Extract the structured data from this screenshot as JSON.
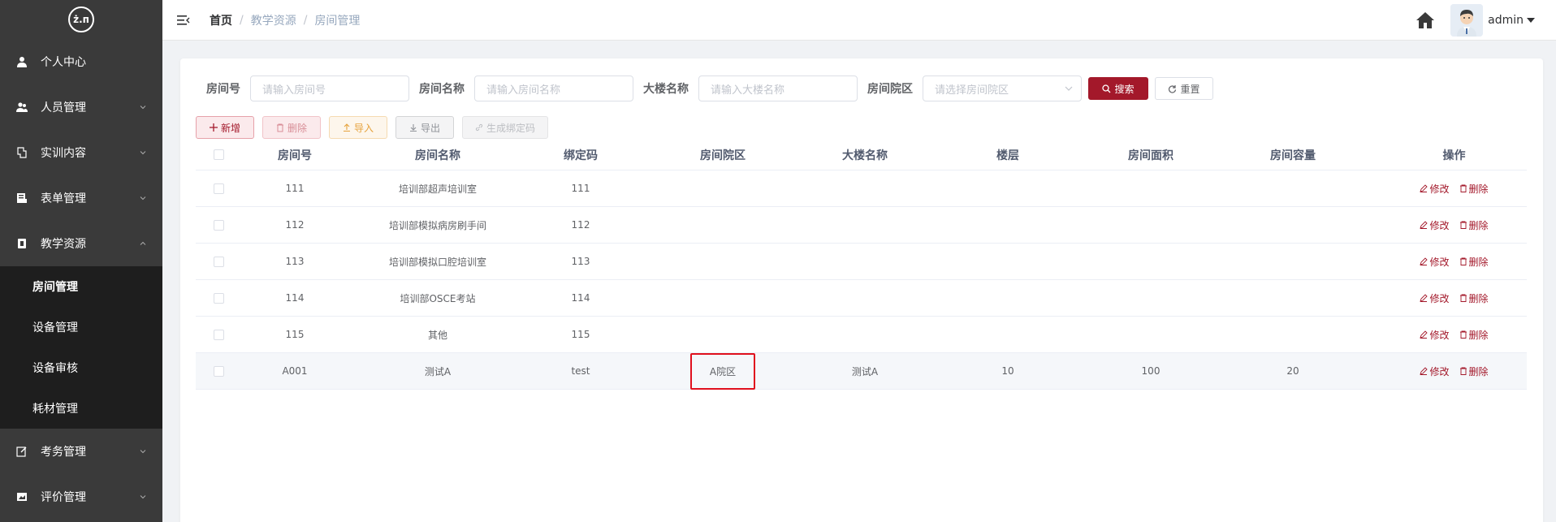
{
  "logo": {
    "text": "ż.п"
  },
  "sidebar": {
    "items": [
      {
        "label": "个人中心",
        "icon": "user-icon",
        "expandable": false
      },
      {
        "label": "人员管理",
        "icon": "people-icon",
        "expandable": true
      },
      {
        "label": "实训内容",
        "icon": "book-icon",
        "expandable": true
      },
      {
        "label": "表单管理",
        "icon": "form-icon",
        "expandable": true
      },
      {
        "label": "教学资源",
        "icon": "resource-icon",
        "expandable": true,
        "open": true
      },
      {
        "label": "考务管理",
        "icon": "edit-icon",
        "expandable": true
      },
      {
        "label": "评价管理",
        "icon": "image-icon",
        "expandable": true
      }
    ],
    "submenu": [
      {
        "label": "房间管理",
        "active": true
      },
      {
        "label": "设备管理"
      },
      {
        "label": "设备审核"
      },
      {
        "label": "耗材管理"
      }
    ]
  },
  "header": {
    "breadcrumb": [
      "首页",
      "教学资源",
      "房间管理"
    ],
    "username": "admin"
  },
  "search": {
    "room_no_label": "房间号",
    "room_no_placeholder": "请输入房间号",
    "room_name_label": "房间名称",
    "room_name_placeholder": "请输入房间名称",
    "building_label": "大楼名称",
    "building_placeholder": "请输入大楼名称",
    "campus_label": "房间院区",
    "campus_placeholder": "请选择房间院区",
    "search_btn": "搜索",
    "reset_btn": "重置"
  },
  "toolbar": {
    "add": "新增",
    "delete": "删除",
    "import": "导入",
    "export": "导出",
    "generate": "生成绑定码"
  },
  "table": {
    "columns": [
      "房间号",
      "房间名称",
      "绑定码",
      "房间院区",
      "大楼名称",
      "楼层",
      "房间面积",
      "房间容量",
      "操作"
    ],
    "rows": [
      {
        "no": "111",
        "name": "培训部超声培训室",
        "code": "111",
        "campus": "",
        "building": "",
        "floor": "",
        "area": "",
        "capacity": ""
      },
      {
        "no": "112",
        "name": "培训部模拟病房刷手间",
        "code": "112",
        "campus": "",
        "building": "",
        "floor": "",
        "area": "",
        "capacity": ""
      },
      {
        "no": "113",
        "name": "培训部模拟口腔培训室",
        "code": "113",
        "campus": "",
        "building": "",
        "floor": "",
        "area": "",
        "capacity": ""
      },
      {
        "no": "114",
        "name": "培训部OSCE考站",
        "code": "114",
        "campus": "",
        "building": "",
        "floor": "",
        "area": "",
        "capacity": ""
      },
      {
        "no": "115",
        "name": "其他",
        "code": "115",
        "campus": "",
        "building": "",
        "floor": "",
        "area": "",
        "capacity": ""
      },
      {
        "no": "A001",
        "name": "测试A",
        "code": "test",
        "campus": "A院区",
        "building": "测试A",
        "floor": "10",
        "area": "100",
        "capacity": "20"
      }
    ],
    "edit_label": "修改",
    "delete_label": "删除"
  },
  "colors": {
    "primary": "#a3182a",
    "sidebar_bg": "#3a3a3a",
    "submenu_bg": "#1e1e1e",
    "highlight_border": "#e0101d"
  }
}
